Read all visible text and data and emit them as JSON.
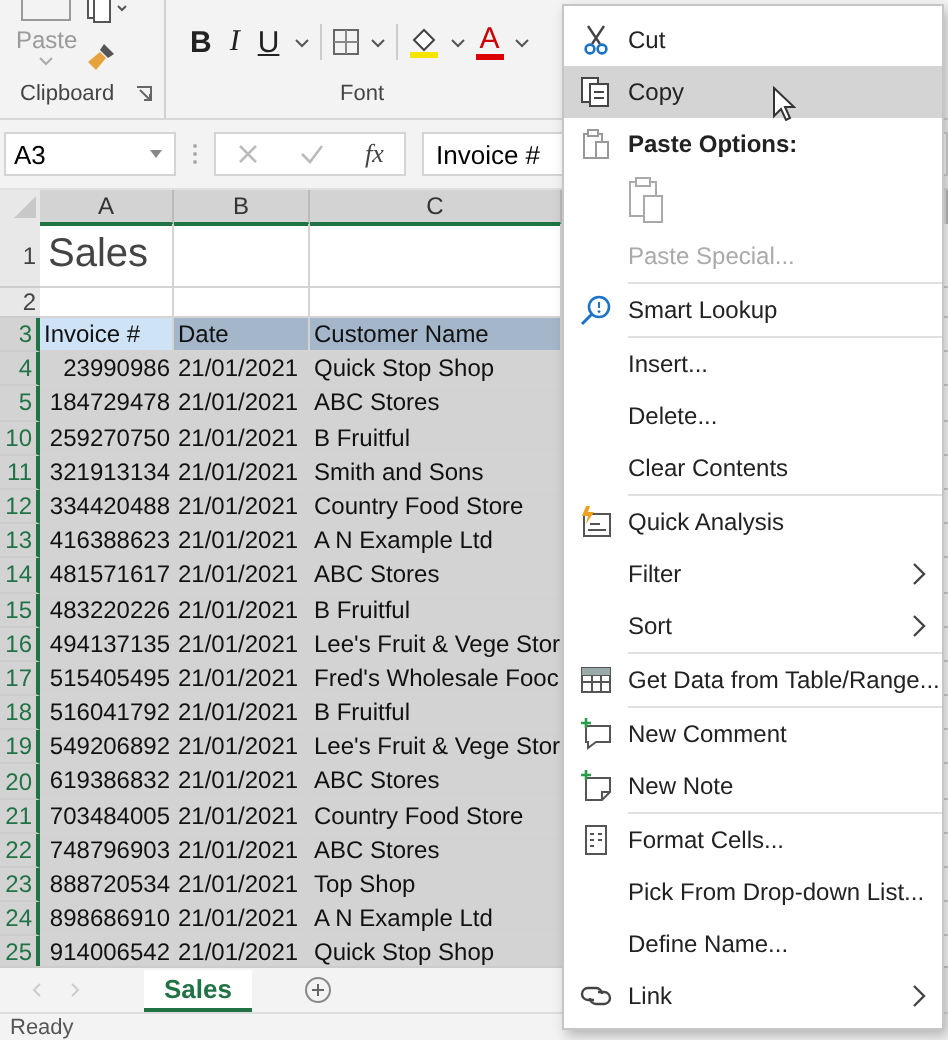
{
  "ribbon": {
    "clipboard": {
      "paste_label": "Paste",
      "group_label": "Clipboard"
    },
    "font": {
      "group_label": "Font",
      "buttons": [
        {
          "label": "B",
          "kind": "bold"
        },
        {
          "label": "I",
          "kind": "italic"
        },
        {
          "label": "U",
          "kind": "underline"
        }
      ],
      "font_color_label": "A"
    }
  },
  "formula_bar": {
    "name_box": "A3",
    "fx": "fx",
    "formula": "Invoice #"
  },
  "sheet": {
    "columns": [
      "A",
      "B",
      "C"
    ],
    "rows": [
      {
        "number": "1",
        "kind": "title",
        "selected": false,
        "cells": [
          {
            "text": "Sales",
            "active": false
          }
        ]
      },
      {
        "number": "2",
        "kind": "blank",
        "selected": false
      },
      {
        "number": "3",
        "kind": "header",
        "selected": true,
        "cells": [
          {
            "text": "Invoice #",
            "active": true
          },
          {
            "text": "Date",
            "active": false
          },
          {
            "text": "Customer Name",
            "active": false
          }
        ]
      },
      {
        "number": "4",
        "kind": "data",
        "selected": true,
        "cells": [
          {
            "text": "23990986",
            "active": false
          },
          {
            "text": "21/01/2021",
            "active": false
          },
          {
            "text": "Quick Stop Shop",
            "active": false
          }
        ]
      },
      {
        "number": "5",
        "kind": "data",
        "selected": true,
        "cells": [
          {
            "text": "184729478",
            "active": false
          },
          {
            "text": "21/01/2021",
            "active": false
          },
          {
            "text": "ABC Stores",
            "active": false
          }
        ]
      },
      {
        "number": "10",
        "kind": "data",
        "selected": true,
        "cells": [
          {
            "text": "259270750",
            "active": false
          },
          {
            "text": "21/01/2021",
            "active": false
          },
          {
            "text": "B Fruitful",
            "active": false
          }
        ]
      },
      {
        "number": "11",
        "kind": "data",
        "selected": true,
        "cells": [
          {
            "text": "321913134",
            "active": false
          },
          {
            "text": "21/01/2021",
            "active": false
          },
          {
            "text": "Smith and Sons",
            "active": false
          }
        ]
      },
      {
        "number": "12",
        "kind": "data",
        "selected": true,
        "cells": [
          {
            "text": "334420488",
            "active": false
          },
          {
            "text": "21/01/2021",
            "active": false
          },
          {
            "text": "Country Food Store",
            "active": false
          }
        ]
      },
      {
        "number": "13",
        "kind": "data",
        "selected": true,
        "cells": [
          {
            "text": "416388623",
            "active": false
          },
          {
            "text": "21/01/2021",
            "active": false
          },
          {
            "text": "A N Example Ltd",
            "active": false
          }
        ]
      },
      {
        "number": "14",
        "kind": "data",
        "selected": true,
        "cells": [
          {
            "text": "481571617",
            "active": false
          },
          {
            "text": "21/01/2021",
            "active": false
          },
          {
            "text": "ABC Stores",
            "active": false
          }
        ]
      },
      {
        "number": "15",
        "kind": "data",
        "selected": true,
        "cells": [
          {
            "text": "483220226",
            "active": false
          },
          {
            "text": "21/01/2021",
            "active": false
          },
          {
            "text": "B Fruitful",
            "active": false
          }
        ]
      },
      {
        "number": "16",
        "kind": "data",
        "selected": true,
        "cells": [
          {
            "text": "494137135",
            "active": false
          },
          {
            "text": "21/01/2021",
            "active": false
          },
          {
            "text": "Lee's Fruit & Vege Stor",
            "active": false
          }
        ]
      },
      {
        "number": "17",
        "kind": "data",
        "selected": true,
        "cells": [
          {
            "text": "515405495",
            "active": false
          },
          {
            "text": "21/01/2021",
            "active": false
          },
          {
            "text": "Fred's Wholesale Fooc",
            "active": false
          }
        ]
      },
      {
        "number": "18",
        "kind": "data",
        "selected": true,
        "cells": [
          {
            "text": "516041792",
            "active": false
          },
          {
            "text": "21/01/2021",
            "active": false
          },
          {
            "text": "B Fruitful",
            "active": false
          }
        ]
      },
      {
        "number": "19",
        "kind": "data",
        "selected": true,
        "cells": [
          {
            "text": "549206892",
            "active": false
          },
          {
            "text": "21/01/2021",
            "active": false
          },
          {
            "text": "Lee's Fruit & Vege Stor",
            "active": false
          }
        ]
      },
      {
        "number": "20",
        "kind": "data",
        "selected": true,
        "cells": [
          {
            "text": "619386832",
            "active": false
          },
          {
            "text": "21/01/2021",
            "active": false
          },
          {
            "text": "ABC Stores",
            "active": false
          }
        ]
      },
      {
        "number": "21",
        "kind": "data",
        "selected": true,
        "cells": [
          {
            "text": "703484005",
            "active": false
          },
          {
            "text": "21/01/2021",
            "active": false
          },
          {
            "text": "Country Food Store",
            "active": false
          }
        ]
      },
      {
        "number": "22",
        "kind": "data",
        "selected": true,
        "cells": [
          {
            "text": "748796903",
            "active": false
          },
          {
            "text": "21/01/2021",
            "active": false
          },
          {
            "text": "ABC Stores",
            "active": false
          }
        ]
      },
      {
        "number": "23",
        "kind": "data",
        "selected": true,
        "cells": [
          {
            "text": "888720534",
            "active": false
          },
          {
            "text": "21/01/2021",
            "active": false
          },
          {
            "text": "Top Shop",
            "active": false
          }
        ]
      },
      {
        "number": "24",
        "kind": "data",
        "selected": true,
        "cells": [
          {
            "text": "898686910",
            "active": false
          },
          {
            "text": "21/01/2021",
            "active": false
          },
          {
            "text": "A N Example Ltd",
            "active": false
          }
        ]
      },
      {
        "number": "25",
        "kind": "data",
        "selected": true,
        "cells": [
          {
            "text": "914006542",
            "active": false
          },
          {
            "text": "21/01/2021",
            "active": false
          },
          {
            "text": "Quick Stop Shop",
            "active": false
          }
        ]
      }
    ]
  },
  "sheet_tabs": [
    {
      "label": "Sales",
      "selected": true
    }
  ],
  "status_bar": {
    "text": "Ready"
  },
  "context_menu": {
    "sections": [
      [
        {
          "kind": "item",
          "label": "Cut",
          "selected": false,
          "disabled": false,
          "submenu": false
        },
        {
          "kind": "item",
          "label": "Copy",
          "selected": true,
          "disabled": false,
          "submenu": false
        },
        {
          "kind": "heading",
          "label": "Paste Options:",
          "selected": false,
          "disabled": false,
          "submenu": false
        },
        {
          "kind": "paste-icons",
          "selected": false,
          "disabled": true,
          "submenu": false
        },
        {
          "kind": "item",
          "label": "Paste Special...",
          "selected": false,
          "disabled": true,
          "submenu": false
        }
      ],
      [
        {
          "kind": "item",
          "label": "Smart Lookup",
          "selected": false,
          "disabled": false,
          "submenu": false
        }
      ],
      [
        {
          "kind": "item",
          "label": "Insert...",
          "selected": false,
          "disabled": false,
          "submenu": false
        },
        {
          "kind": "item",
          "label": "Delete...",
          "selected": false,
          "disabled": false,
          "submenu": false
        },
        {
          "kind": "item",
          "label": "Clear Contents",
          "selected": false,
          "disabled": false,
          "submenu": false
        }
      ],
      [
        {
          "kind": "item",
          "label": "Quick Analysis",
          "selected": false,
          "disabled": false,
          "submenu": false
        },
        {
          "kind": "item",
          "label": "Filter",
          "selected": false,
          "disabled": false,
          "submenu": true
        },
        {
          "kind": "item",
          "label": "Sort",
          "selected": false,
          "disabled": false,
          "submenu": true
        }
      ],
      [
        {
          "kind": "item",
          "label": "Get Data from Table/Range...",
          "selected": false,
          "disabled": false,
          "submenu": false
        }
      ],
      [
        {
          "kind": "item",
          "label": "New Comment",
          "selected": false,
          "disabled": false,
          "submenu": false
        },
        {
          "kind": "item",
          "label": "New Note",
          "selected": false,
          "disabled": false,
          "submenu": false
        }
      ],
      [
        {
          "kind": "item",
          "label": "Format Cells...",
          "selected": false,
          "disabled": false,
          "submenu": false
        },
        {
          "kind": "item",
          "label": "Pick From Drop-down List...",
          "selected": false,
          "disabled": false,
          "submenu": false
        },
        {
          "kind": "item",
          "label": "Define Name...",
          "selected": false,
          "disabled": false,
          "submenu": false
        },
        {
          "kind": "item",
          "label": "Link",
          "selected": false,
          "disabled": false,
          "submenu": true
        }
      ]
    ]
  }
}
